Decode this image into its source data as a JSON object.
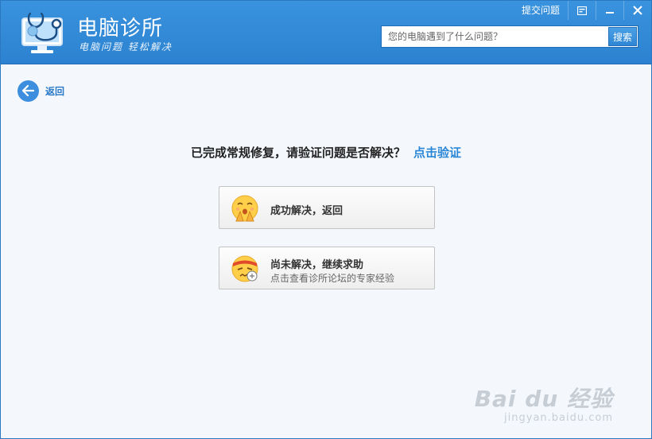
{
  "header": {
    "app_title": "电脑诊所",
    "slogan": "电脑问题 轻松解决",
    "feedback_link": "提交问题",
    "search": {
      "placeholder": "您的电脑遇到了什么问题？",
      "button_label": "搜索"
    },
    "icons": {
      "logo": "monitor-stethoscope-icon",
      "settings": "settings-icon",
      "minimize": "minimize-icon",
      "close": "close-icon"
    }
  },
  "back": {
    "label": "返回",
    "icon": "arrow-left-icon"
  },
  "main": {
    "question": "已完成常规修复，请验证问题是否解决？",
    "verify_link": "点击验证",
    "options": [
      {
        "label": "成功解决，返回",
        "icon": "happy-face-icon"
      },
      {
        "label": "尚未解决，继续求助",
        "sub": "点击查看诊所论坛的专家经验",
        "icon": "frustrated-face-icon"
      }
    ]
  },
  "watermark": {
    "main": "Bai du 经验",
    "sub": "jingyan.baidu.com"
  },
  "colors": {
    "header": "#2c82d0",
    "accent": "#2a86d6",
    "background": "#f4f8fc"
  }
}
